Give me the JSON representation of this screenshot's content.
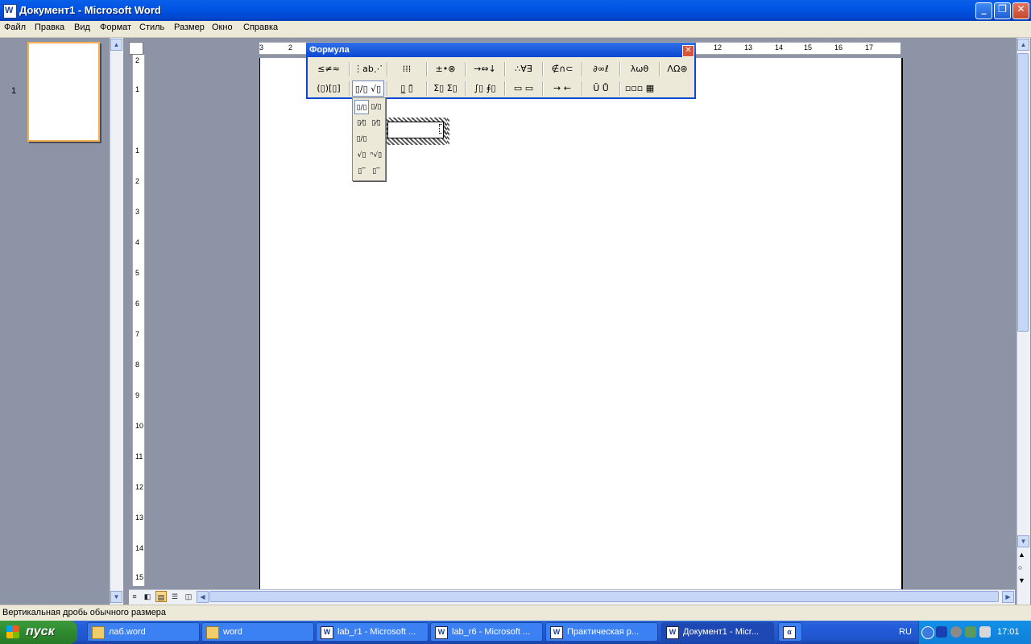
{
  "window": {
    "title": "Документ1 - Microsoft Word",
    "app_icon_letter": "W"
  },
  "menu": [
    "Файл",
    "Правка",
    "Вид",
    "Формат",
    "Стиль",
    "Размер",
    "Окно",
    "Справка"
  ],
  "thumbnails": {
    "page_number": "1"
  },
  "ruler": {
    "horizontal": [
      "3",
      "2",
      "12",
      "13",
      "14",
      "15",
      "16",
      "17"
    ],
    "vertical": [
      "2",
      "1",
      "1",
      "2",
      "3",
      "4",
      "5",
      "6",
      "7",
      "8",
      "9",
      "10",
      "11",
      "12",
      "13",
      "14",
      "15"
    ]
  },
  "formula_toolbar": {
    "title": "Формула",
    "row1": [
      "≤≠≈",
      "⋮ab⋰",
      "⁞⁞⁞",
      "±•⊗",
      "→⇔↓",
      "∴∀∃",
      "∉∩⊂",
      "∂∞ℓ",
      "λωθ",
      "ΛΩ⊛"
    ],
    "row2": [
      "(▯)[▯]",
      "▯/▯ √▯",
      "▯̲ ▯̄",
      "Σ▯ Σ▯",
      "∫▯ ∮▯",
      "▭ ▭",
      "→ ←",
      "Ū Ů",
      "▫▫▫ ▦"
    ]
  },
  "template_dropdown": [
    "▯/▯",
    "▯/▯",
    "▯⁄▯",
    "▯⁄▯",
    "▯/▯",
    "√▯",
    "ⁿ√▯",
    "▯‾",
    "▯‾"
  ],
  "status": {
    "text": "Вертикальная дробь обычного размера"
  },
  "taskbar": {
    "start_label": "пуск",
    "tasks": [
      {
        "label": "лаб.word",
        "icon": "folder"
      },
      {
        "label": "word",
        "icon": "folder"
      },
      {
        "label": "lab_r1 - Microsoft ...",
        "icon": "W"
      },
      {
        "label": "lab_r6 - Microsoft ...",
        "icon": "W"
      },
      {
        "label": "Практическая р...",
        "icon": "W"
      },
      {
        "label": "Документ1 - Micr...",
        "icon": "W"
      },
      {
        "label": "",
        "icon": "α"
      }
    ],
    "language": "RU",
    "clock": "17:01"
  }
}
